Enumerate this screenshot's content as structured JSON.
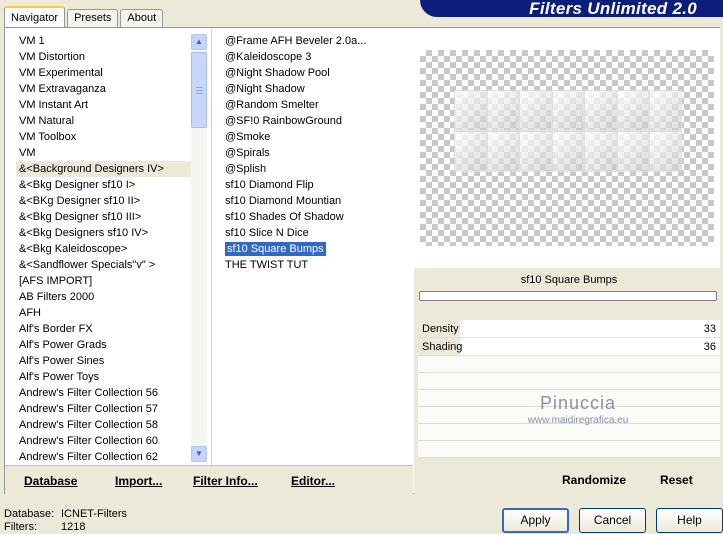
{
  "window": {
    "brand_title": "Filters Unlimited 2.0",
    "tabs": [
      {
        "label": "Navigator",
        "active": true
      },
      {
        "label": "Presets",
        "active": false
      },
      {
        "label": "About",
        "active": false
      }
    ]
  },
  "categories": [
    "VM 1",
    "VM Distortion",
    "VM Experimental",
    "VM Extravaganza",
    "VM Instant Art",
    "VM Natural",
    "VM Toolbox",
    "VM",
    "&<Background Designers IV>",
    "&<Bkg Designer sf10 I>",
    "&<BKg Designer sf10 II>",
    "&<Bkg Designer sf10 III>",
    "&<Bkg Designers sf10 IV>",
    "&<Bkg Kaleidoscope>",
    "&<Sandflower Specials\"v\" >",
    "[AFS IMPORT]",
    "AB Filters 2000",
    "AFH",
    "Alf's Border FX",
    "Alf's Power Grads",
    "Alf's Power Sines",
    "Alf's Power Toys",
    "Andrew's Filter Collection 56",
    "Andrew's Filter Collection 57",
    "Andrew's Filter Collection 58",
    "Andrew's Filter Collection 60",
    "Andrew's Filter Collection 62"
  ],
  "highlighted_category_index": 8,
  "filters": [
    "@Frame AFH Beveler 2.0a...",
    "@Kaleidoscope 3",
    "@Night Shadow Pool",
    "@Night Shadow",
    "@Random Smelter",
    "@SF!0 RainbowGround",
    "@Smoke",
    "@Spirals",
    "@Splish",
    "sf10 Diamond Flip",
    "sf10 Diamond Mountian",
    "sf10 Shades Of Shadow",
    "sf10 Slice N Dice",
    "sf10 Square Bumps",
    "THE TWIST TUT"
  ],
  "selected_filter_index": 13,
  "preview": {
    "filter_name": "sf10 Square Bumps",
    "watermark_line1": "Pinuccia",
    "watermark_line2": "www.maidiregrafica.eu"
  },
  "parameters": [
    {
      "name": "Density",
      "value": "33"
    },
    {
      "name": "Shading",
      "value": "36"
    }
  ],
  "bottom_buttons": {
    "database": "Database",
    "import": "Import...",
    "filter_info": "Filter Info...",
    "editor": "Editor...",
    "randomize": "Randomize",
    "reset": "Reset"
  },
  "status": {
    "database_label": "Database:",
    "database_value": "ICNET-Filters",
    "filters_label": "Filters:",
    "filters_value": "1218"
  },
  "dialog_buttons": {
    "apply": "Apply",
    "cancel": "Cancel",
    "help": "Help"
  },
  "colors": {
    "selection": "#316ac5",
    "brand_banner": "#0b1f7a",
    "dialog_background": "#ece9d8"
  }
}
